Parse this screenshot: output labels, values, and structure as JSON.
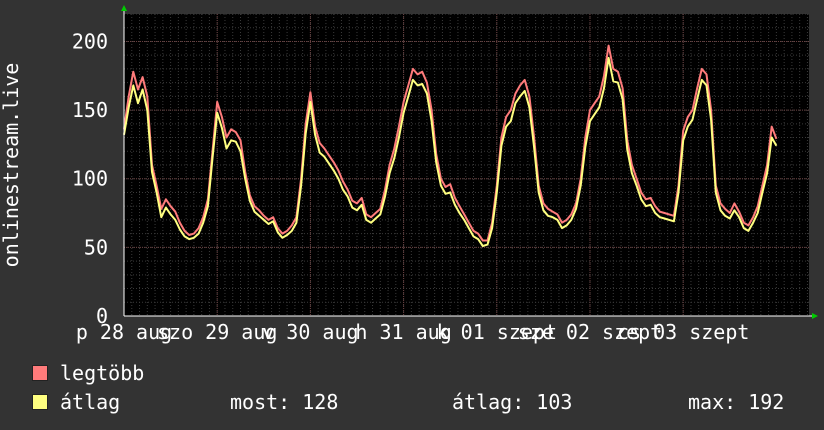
{
  "chart_data": {
    "type": "line",
    "ylabel": "onlinestream.live",
    "ylim": [
      0,
      220
    ],
    "y_ticks": [
      0,
      50,
      100,
      150,
      200
    ],
    "grid": true,
    "xlim": [
      0,
      7.35
    ],
    "x_ticks": [
      {
        "x": 0,
        "label": "p 28 aug"
      },
      {
        "x": 1,
        "label": "szo 29 aug"
      },
      {
        "x": 2,
        "label": "v 30 aug"
      },
      {
        "x": 3,
        "label": "h 31 aug"
      },
      {
        "x": 4,
        "label": "k 01 szept"
      },
      {
        "x": 5,
        "label": "sze 02 szept"
      },
      {
        "x": 6,
        "label": "cs 03 szept"
      }
    ],
    "series": [
      {
        "name": "legtöbb",
        "color": "#ff7b7b",
        "points": [
          [
            0.0,
            136
          ],
          [
            0.05,
            160
          ],
          [
            0.1,
            178
          ],
          [
            0.15,
            165
          ],
          [
            0.2,
            174
          ],
          [
            0.25,
            160
          ],
          [
            0.3,
            110
          ],
          [
            0.35,
            95
          ],
          [
            0.4,
            78
          ],
          [
            0.45,
            85
          ],
          [
            0.5,
            80
          ],
          [
            0.55,
            76
          ],
          [
            0.6,
            68
          ],
          [
            0.65,
            62
          ],
          [
            0.7,
            59
          ],
          [
            0.75,
            60
          ],
          [
            0.8,
            64
          ],
          [
            0.85,
            72
          ],
          [
            0.9,
            85
          ],
          [
            0.95,
            120
          ],
          [
            1.0,
            156
          ],
          [
            1.05,
            145
          ],
          [
            1.1,
            130
          ],
          [
            1.15,
            136
          ],
          [
            1.2,
            134
          ],
          [
            1.25,
            128
          ],
          [
            1.3,
            105
          ],
          [
            1.35,
            88
          ],
          [
            1.4,
            80
          ],
          [
            1.45,
            77
          ],
          [
            1.5,
            73
          ],
          [
            1.55,
            70
          ],
          [
            1.6,
            72
          ],
          [
            1.65,
            64
          ],
          [
            1.7,
            60
          ],
          [
            1.75,
            62
          ],
          [
            1.8,
            66
          ],
          [
            1.85,
            72
          ],
          [
            1.9,
            100
          ],
          [
            1.95,
            140
          ],
          [
            2.0,
            163
          ],
          [
            2.05,
            138
          ],
          [
            2.1,
            126
          ],
          [
            2.15,
            122
          ],
          [
            2.2,
            117
          ],
          [
            2.25,
            112
          ],
          [
            2.3,
            106
          ],
          [
            2.35,
            98
          ],
          [
            2.4,
            92
          ],
          [
            2.45,
            84
          ],
          [
            2.5,
            82
          ],
          [
            2.55,
            86
          ],
          [
            2.6,
            74
          ],
          [
            2.65,
            72
          ],
          [
            2.7,
            75
          ],
          [
            2.75,
            78
          ],
          [
            2.8,
            92
          ],
          [
            2.85,
            110
          ],
          [
            2.9,
            122
          ],
          [
            2.95,
            138
          ],
          [
            3.0,
            156
          ],
          [
            3.05,
            168
          ],
          [
            3.1,
            180
          ],
          [
            3.15,
            176
          ],
          [
            3.2,
            178
          ],
          [
            3.25,
            170
          ],
          [
            3.3,
            150
          ],
          [
            3.35,
            118
          ],
          [
            3.4,
            100
          ],
          [
            3.45,
            94
          ],
          [
            3.5,
            96
          ],
          [
            3.55,
            86
          ],
          [
            3.6,
            80
          ],
          [
            3.65,
            74
          ],
          [
            3.7,
            68
          ],
          [
            3.75,
            62
          ],
          [
            3.8,
            60
          ],
          [
            3.85,
            55
          ],
          [
            3.9,
            55
          ],
          [
            3.95,
            68
          ],
          [
            4.0,
            95
          ],
          [
            4.05,
            130
          ],
          [
            4.1,
            145
          ],
          [
            4.15,
            150
          ],
          [
            4.2,
            162
          ],
          [
            4.25,
            168
          ],
          [
            4.3,
            172
          ],
          [
            4.35,
            160
          ],
          [
            4.4,
            130
          ],
          [
            4.45,
            95
          ],
          [
            4.5,
            82
          ],
          [
            4.55,
            78
          ],
          [
            4.6,
            76
          ],
          [
            4.65,
            74
          ],
          [
            4.7,
            68
          ],
          [
            4.75,
            70
          ],
          [
            4.8,
            74
          ],
          [
            4.85,
            82
          ],
          [
            4.9,
            100
          ],
          [
            4.95,
            130
          ],
          [
            5.0,
            150
          ],
          [
            5.05,
            155
          ],
          [
            5.1,
            160
          ],
          [
            5.15,
            175
          ],
          [
            5.2,
            197
          ],
          [
            5.25,
            180
          ],
          [
            5.3,
            178
          ],
          [
            5.35,
            166
          ],
          [
            5.4,
            128
          ],
          [
            5.45,
            110
          ],
          [
            5.5,
            100
          ],
          [
            5.55,
            90
          ],
          [
            5.6,
            85
          ],
          [
            5.65,
            86
          ],
          [
            5.7,
            80
          ],
          [
            5.75,
            76
          ],
          [
            5.8,
            75
          ],
          [
            5.85,
            74
          ],
          [
            5.9,
            73
          ],
          [
            5.95,
            95
          ],
          [
            6.0,
            135
          ],
          [
            6.05,
            145
          ],
          [
            6.1,
            150
          ],
          [
            6.15,
            166
          ],
          [
            6.2,
            180
          ],
          [
            6.25,
            176
          ],
          [
            6.3,
            150
          ],
          [
            6.35,
            95
          ],
          [
            6.4,
            82
          ],
          [
            6.45,
            78
          ],
          [
            6.5,
            75
          ],
          [
            6.55,
            82
          ],
          [
            6.6,
            76
          ],
          [
            6.65,
            68
          ],
          [
            6.7,
            66
          ],
          [
            6.75,
            72
          ],
          [
            6.8,
            80
          ],
          [
            6.85,
            95
          ],
          [
            6.9,
            110
          ],
          [
            6.95,
            138
          ],
          [
            7.0,
            129
          ]
        ]
      },
      {
        "name": "átlag",
        "color": "#ffff80",
        "points": [
          [
            0.0,
            132
          ],
          [
            0.05,
            152
          ],
          [
            0.1,
            168
          ],
          [
            0.15,
            155
          ],
          [
            0.2,
            165
          ],
          [
            0.25,
            150
          ],
          [
            0.3,
            105
          ],
          [
            0.35,
            90
          ],
          [
            0.4,
            72
          ],
          [
            0.45,
            79
          ],
          [
            0.5,
            74
          ],
          [
            0.55,
            70
          ],
          [
            0.6,
            63
          ],
          [
            0.65,
            58
          ],
          [
            0.7,
            56
          ],
          [
            0.75,
            57
          ],
          [
            0.8,
            60
          ],
          [
            0.85,
            68
          ],
          [
            0.9,
            80
          ],
          [
            0.95,
            115
          ],
          [
            1.0,
            148
          ],
          [
            1.05,
            137
          ],
          [
            1.1,
            122
          ],
          [
            1.15,
            128
          ],
          [
            1.2,
            127
          ],
          [
            1.25,
            120
          ],
          [
            1.3,
            100
          ],
          [
            1.35,
            84
          ],
          [
            1.4,
            76
          ],
          [
            1.45,
            73
          ],
          [
            1.5,
            70
          ],
          [
            1.55,
            67
          ],
          [
            1.6,
            69
          ],
          [
            1.65,
            61
          ],
          [
            1.7,
            57
          ],
          [
            1.75,
            59
          ],
          [
            1.8,
            62
          ],
          [
            1.85,
            68
          ],
          [
            1.9,
            95
          ],
          [
            1.95,
            133
          ],
          [
            2.0,
            156
          ],
          [
            2.05,
            132
          ],
          [
            2.1,
            119
          ],
          [
            2.15,
            116
          ],
          [
            2.2,
            111
          ],
          [
            2.25,
            106
          ],
          [
            2.3,
            100
          ],
          [
            2.35,
            92
          ],
          [
            2.4,
            87
          ],
          [
            2.45,
            79
          ],
          [
            2.5,
            77
          ],
          [
            2.55,
            81
          ],
          [
            2.6,
            70
          ],
          [
            2.65,
            68
          ],
          [
            2.7,
            71
          ],
          [
            2.75,
            74
          ],
          [
            2.8,
            87
          ],
          [
            2.85,
            104
          ],
          [
            2.9,
            115
          ],
          [
            2.95,
            130
          ],
          [
            3.0,
            148
          ],
          [
            3.05,
            160
          ],
          [
            3.1,
            172
          ],
          [
            3.15,
            168
          ],
          [
            3.2,
            169
          ],
          [
            3.25,
            162
          ],
          [
            3.3,
            142
          ],
          [
            3.35,
            112
          ],
          [
            3.4,
            95
          ],
          [
            3.45,
            89
          ],
          [
            3.5,
            90
          ],
          [
            3.55,
            81
          ],
          [
            3.6,
            75
          ],
          [
            3.65,
            70
          ],
          [
            3.7,
            64
          ],
          [
            3.75,
            58
          ],
          [
            3.8,
            56
          ],
          [
            3.85,
            51
          ],
          [
            3.9,
            52
          ],
          [
            3.95,
            64
          ],
          [
            4.0,
            90
          ],
          [
            4.05,
            124
          ],
          [
            4.1,
            138
          ],
          [
            4.15,
            142
          ],
          [
            4.2,
            155
          ],
          [
            4.25,
            160
          ],
          [
            4.3,
            164
          ],
          [
            4.35,
            152
          ],
          [
            4.4,
            123
          ],
          [
            4.45,
            90
          ],
          [
            4.5,
            77
          ],
          [
            4.55,
            73
          ],
          [
            4.6,
            72
          ],
          [
            4.65,
            70
          ],
          [
            4.7,
            64
          ],
          [
            4.75,
            66
          ],
          [
            4.8,
            70
          ],
          [
            4.85,
            78
          ],
          [
            4.9,
            95
          ],
          [
            4.95,
            123
          ],
          [
            5.0,
            142
          ],
          [
            5.05,
            147
          ],
          [
            5.1,
            152
          ],
          [
            5.15,
            166
          ],
          [
            5.2,
            188
          ],
          [
            5.25,
            171
          ],
          [
            5.3,
            170
          ],
          [
            5.35,
            158
          ],
          [
            5.4,
            121
          ],
          [
            5.45,
            104
          ],
          [
            5.5,
            95
          ],
          [
            5.55,
            85
          ],
          [
            5.6,
            80
          ],
          [
            5.65,
            81
          ],
          [
            5.7,
            75
          ],
          [
            5.75,
            72
          ],
          [
            5.8,
            71
          ],
          [
            5.85,
            70
          ],
          [
            5.9,
            69
          ],
          [
            5.95,
            90
          ],
          [
            6.0,
            128
          ],
          [
            6.05,
            138
          ],
          [
            6.1,
            143
          ],
          [
            6.15,
            158
          ],
          [
            6.2,
            172
          ],
          [
            6.25,
            168
          ],
          [
            6.3,
            143
          ],
          [
            6.35,
            90
          ],
          [
            6.4,
            77
          ],
          [
            6.45,
            73
          ],
          [
            6.5,
            71
          ],
          [
            6.55,
            77
          ],
          [
            6.6,
            72
          ],
          [
            6.65,
            64
          ],
          [
            6.7,
            62
          ],
          [
            6.75,
            68
          ],
          [
            6.8,
            75
          ],
          [
            6.85,
            90
          ],
          [
            6.9,
            104
          ],
          [
            6.95,
            130
          ],
          [
            7.0,
            124
          ]
        ]
      }
    ]
  },
  "legend": [
    {
      "label": "legtöbb",
      "color": "#ff7b7b"
    },
    {
      "label": "átlag",
      "color": "#ffff80"
    }
  ],
  "stats": {
    "most": "most: 128",
    "atlag": "átlag: 103",
    "max": "max: 192"
  }
}
